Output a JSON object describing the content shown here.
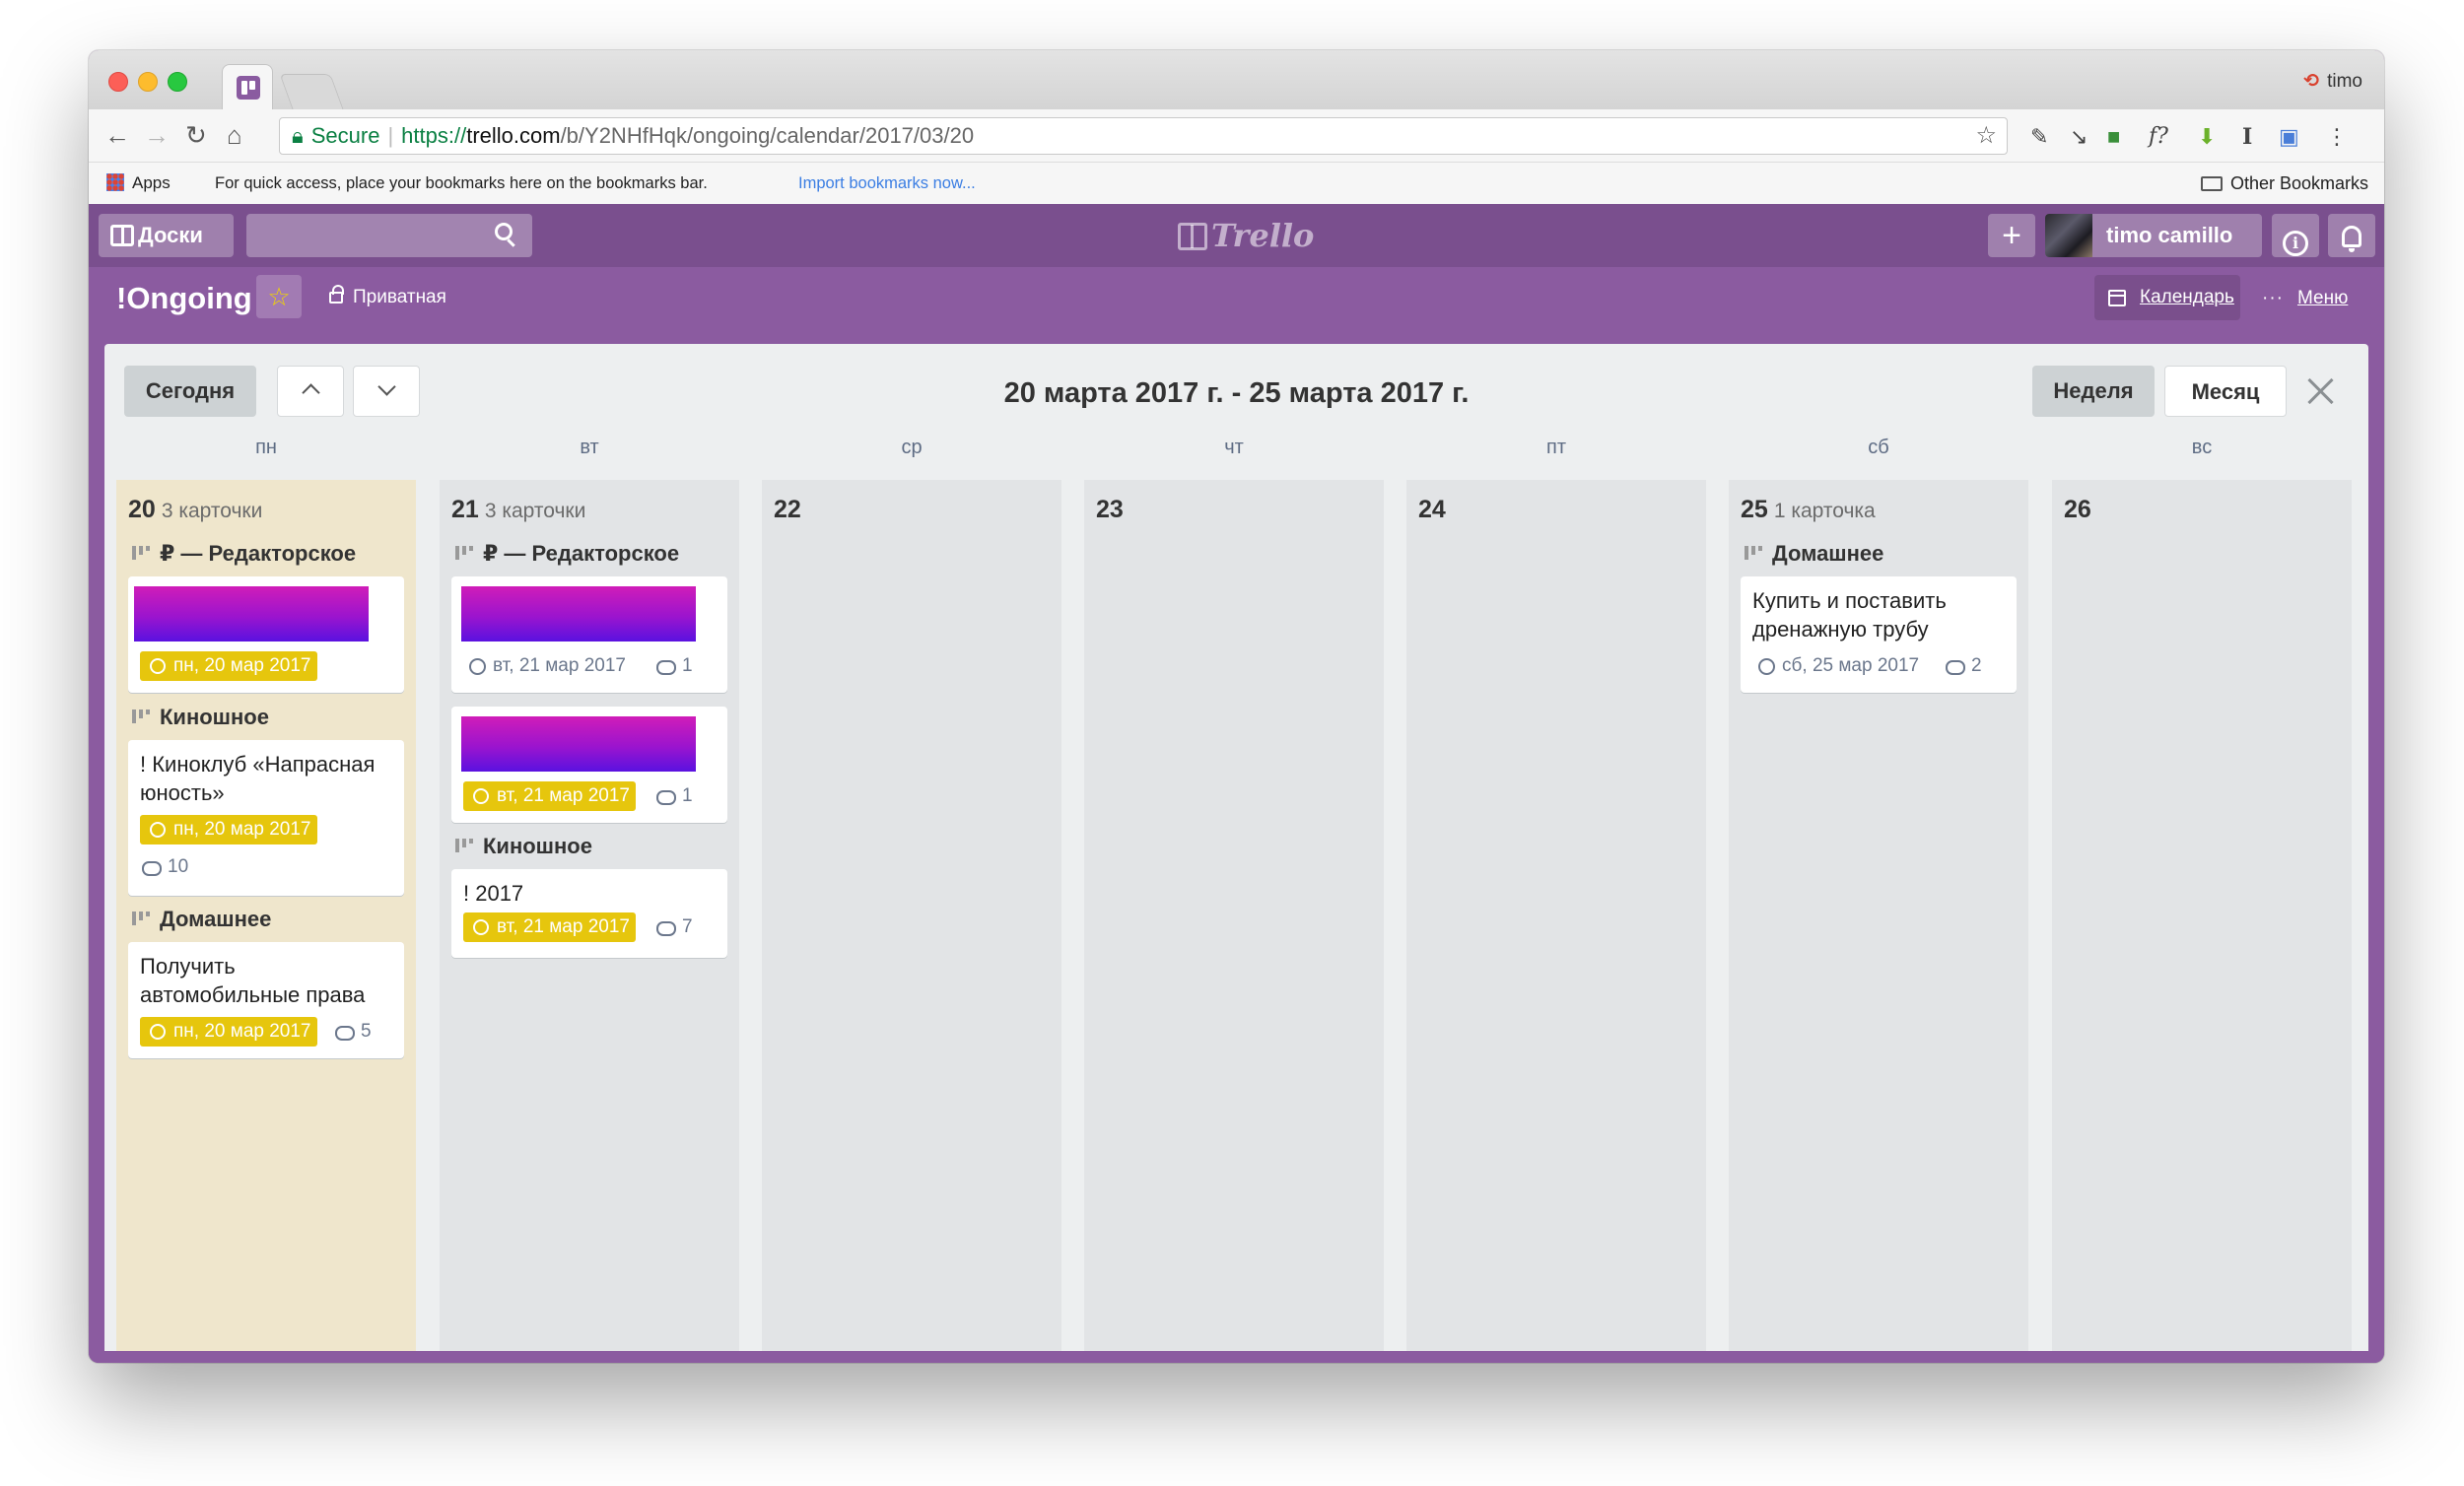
{
  "browser": {
    "profile": "timo",
    "url": {
      "secure_label": "Secure",
      "scheme": "https://",
      "host": "trello.com",
      "path": "/b/Y2NHfHqk/ongoing/calendar/2017/03/20"
    },
    "bookmarks": {
      "apps": "Apps",
      "hint": "For quick access, place your bookmarks here on the bookmarks bar.",
      "import": "Import bookmarks now...",
      "other": "Other Bookmarks"
    }
  },
  "header": {
    "boards_label": "Доски",
    "logo": "Trello",
    "user_name": "timo camillo",
    "plus": "+",
    "info": "i"
  },
  "board": {
    "title": "!Ongoing",
    "visibility": "Приватная",
    "calendar_link": "Календарь",
    "menu_link": "Меню"
  },
  "calendar": {
    "today_label": "Сегодня",
    "range": "20 марта 2017 г. - 25 марта 2017 г.",
    "week_label": "Неделя",
    "month_label": "Месяц",
    "weekdays": [
      "пн",
      "вт",
      "ср",
      "чт",
      "пт",
      "сб",
      "вс"
    ],
    "days": [
      {
        "num": "20",
        "count": "3 карточки"
      },
      {
        "num": "21",
        "count": "3 карточки"
      },
      {
        "num": "22",
        "count": ""
      },
      {
        "num": "23",
        "count": ""
      },
      {
        "num": "24",
        "count": ""
      },
      {
        "num": "25",
        "count": "1 карточка"
      },
      {
        "num": "26",
        "count": ""
      }
    ],
    "mon": {
      "list1": "₽ — Редакторское",
      "card1_due": "пн, 20 мар 2017",
      "list2": "Киношное",
      "card2_title": "! Киноклуб «Напрасная юность»",
      "card2_due": "пн, 20 мар 2017",
      "card2_comments": "10",
      "list3": "Домашнее",
      "card3_title": "Получить автомобильные права",
      "card3_due": "пн, 20 мар 2017",
      "card3_comments": "5"
    },
    "tue": {
      "list1": "₽ — Редакторское",
      "card1_date": "вт, 21 мар 2017",
      "card1_comments": "1",
      "card2_due": "вт, 21 мар 2017",
      "card2_comments": "1",
      "list2": "Киношное",
      "card3_title": "! 2017",
      "card3_due": "вт, 21 мар 2017",
      "card3_comments": "7"
    },
    "sat": {
      "list1": "Домашнее",
      "card1_title": "Купить и поставить дренажную трубу",
      "card1_date": "сб, 25 мар 2017",
      "card1_comments": "2"
    }
  },
  "colors": {
    "board_purple": "#8b5ba0",
    "header_purple": "#7a4f8e",
    "due_yellow": "#e6c60d",
    "today_bg": "#efe6cc"
  }
}
